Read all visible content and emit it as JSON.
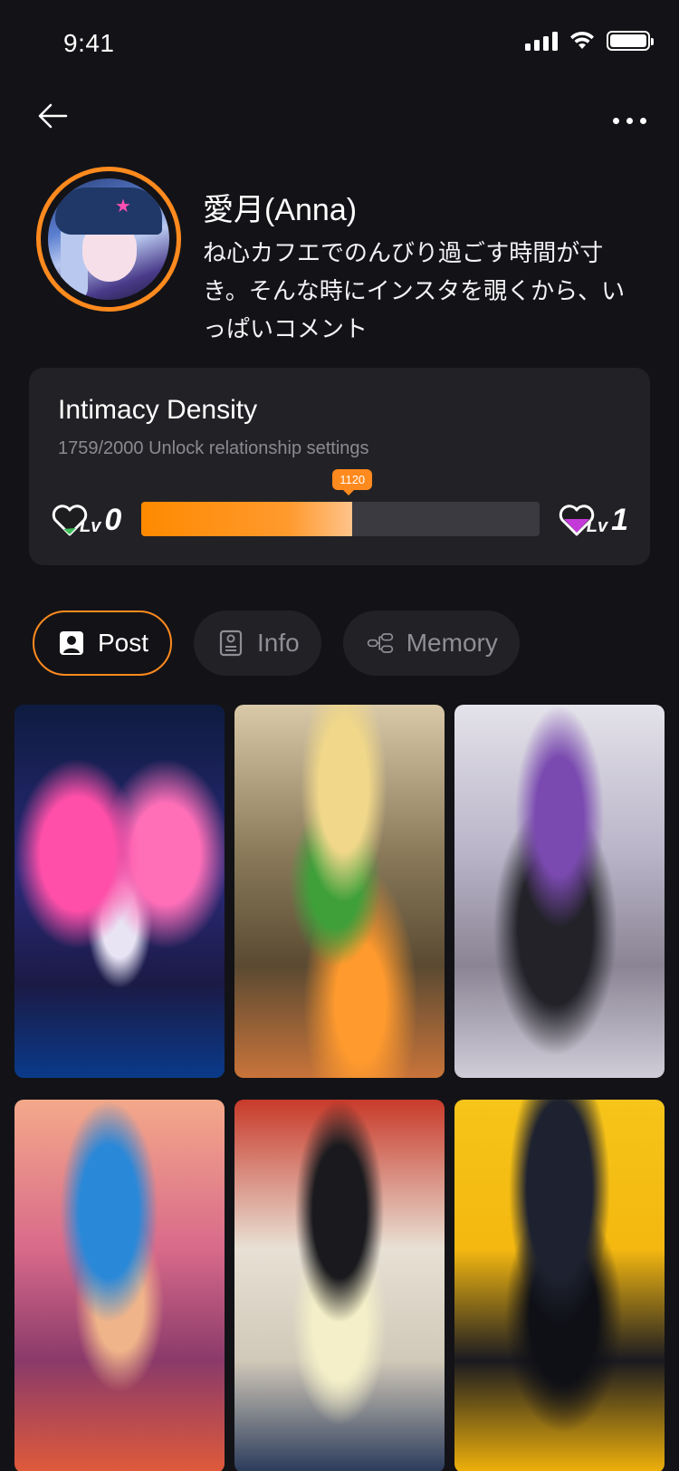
{
  "status_bar": {
    "time": "9:41"
  },
  "profile": {
    "name": "愛月(Anna)",
    "bio": "ね心カフエでのんびり過ごす時間が寸き。そんな時にインスタを覗くから、いっぱいコメント"
  },
  "intimacy": {
    "title": "Intimacy Density",
    "subtitle": "1759/2000 Unlock relationship settings",
    "marker": "1120",
    "progress_fraction": 0.53,
    "level_current_prefix": "Lv",
    "level_current": "0",
    "level_next_prefix": "Lv",
    "level_next": "1",
    "colors": {
      "accent": "#ff8a1e",
      "heart_current": "#3fbf5a",
      "heart_next": "#c43ad8"
    }
  },
  "tabs": [
    {
      "label": "Post",
      "icon": "person-card-icon",
      "active": true
    },
    {
      "label": "Info",
      "icon": "id-card-icon",
      "active": false
    },
    {
      "label": "Memory",
      "icon": "memory-nodes-icon",
      "active": false
    }
  ],
  "posts": [
    {
      "subject": "butterfly-girl-post"
    },
    {
      "subject": "running-girl-post"
    },
    {
      "subject": "purple-hair-girl-post"
    },
    {
      "subject": "blue-hair-goggles-post"
    },
    {
      "subject": "twin-tails-girl-post"
    },
    {
      "subject": "beanie-cat-girl-post"
    }
  ]
}
